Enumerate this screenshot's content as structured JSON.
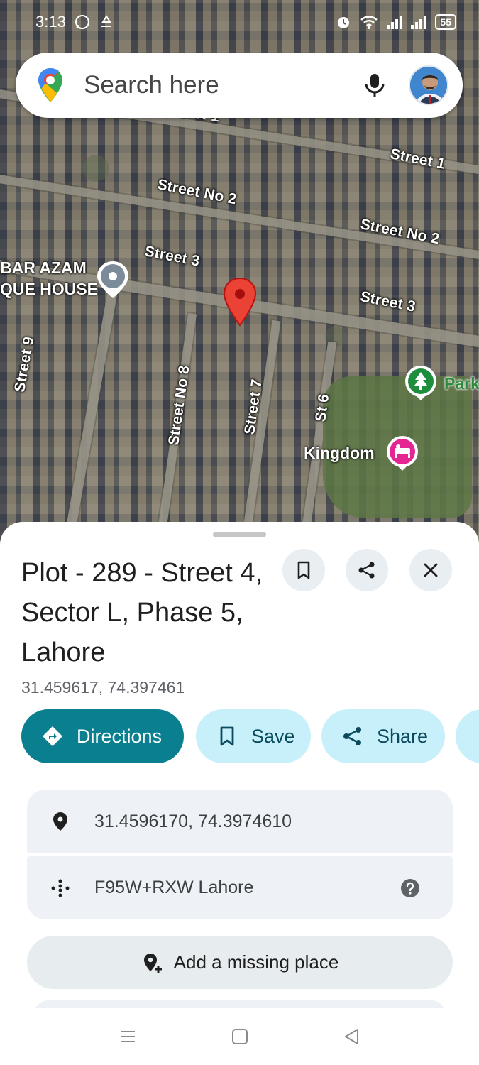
{
  "status_bar": {
    "time": "3:13",
    "battery": "55"
  },
  "search": {
    "placeholder": "Search here"
  },
  "map": {
    "street_labels": [
      "Street 1",
      "Street No 2",
      "Street No 2",
      "Street 3",
      "Street 3",
      "Street 9",
      "Street No 8",
      "Street 7",
      "St 6",
      "Street 1"
    ],
    "place_labels": {
      "house_line1": "BAR AZAM",
      "house_line2": "QUE HOUSE",
      "park": "Park",
      "kingdom": "Kingdom"
    }
  },
  "place": {
    "title": "Plot - 289 - Street 4, Sector L, Phase 5, Lahore",
    "coordinates": "31.459617, 74.397461"
  },
  "actions": {
    "directions": "Directions",
    "save": "Save",
    "share": "Share"
  },
  "details": {
    "full_coordinates": "31.4596170, 74.3974610",
    "plus_code": "F95W+RXW Lahore"
  },
  "add_missing_place": "Add a missing place",
  "icons": {
    "status": [
      "whatsapp-icon",
      "recycle-icon",
      "alarm-icon",
      "wifi-icon",
      "signal-icon",
      "battery-icon"
    ],
    "search": [
      "google-maps-logo-icon",
      "mic-icon",
      "avatar"
    ],
    "sheet": [
      "bookmark-icon",
      "share-icon",
      "close-icon",
      "directions-icon",
      "location-pin-icon",
      "plus-code-icon",
      "help-icon",
      "add-place-icon"
    ],
    "nav": [
      "recents-icon",
      "home-icon",
      "back-icon"
    ]
  },
  "colors": {
    "primary_button": "#097f8f",
    "secondary_button": "#c8f0fb",
    "pin_red": "#ea4335",
    "park_pin": "#1e8e3e",
    "hotel_pin": "#e52592"
  }
}
